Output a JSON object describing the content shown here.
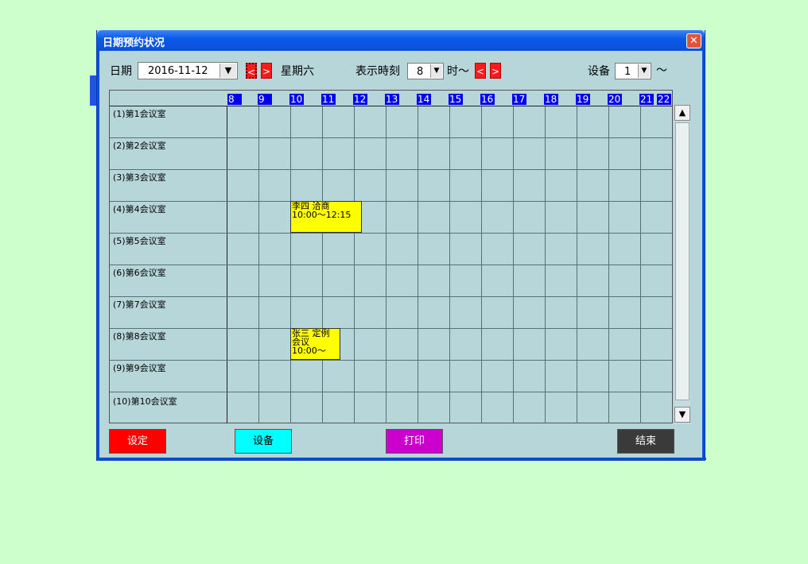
{
  "window": {
    "title": "日期预约状况",
    "close_icon": "close-icon"
  },
  "toolbar": {
    "date_label": "日期",
    "date_value": "2016-11-12",
    "weekday": "星期六",
    "display_time_label": "表示時刻",
    "display_time_value": "8",
    "hour_suffix": "时～",
    "device_label": "设备",
    "device_value": "1",
    "device_suffix": "～",
    "prev_symbol": "<",
    "next_symbol": ">"
  },
  "hours": [
    "8",
    "9",
    "10",
    "11",
    "12",
    "13",
    "14",
    "15",
    "16",
    "17",
    "18",
    "19",
    "20",
    "21",
    "22"
  ],
  "rooms": [
    "(1)第1会议室",
    "(2)第2会议室",
    "(3)第3会议室",
    "(4)第4会议室",
    "(5)第5会议室",
    "(6)第6会议室",
    "(7)第7会议室",
    "(8)第8会议室",
    "(9)第9会议室",
    "(10)第10会议室"
  ],
  "bookings": [
    {
      "line1": "李四 洽商",
      "line2": "10:00～12:15",
      "line3": ""
    },
    {
      "line1": "张三 定例",
      "line2": "会议",
      "line3": "10:00～"
    }
  ],
  "buttons": {
    "settings": "设定",
    "device": "设备",
    "print": "打印",
    "end": "结束"
  },
  "colors": {
    "settings": "#ff0000",
    "device": "#00ffff",
    "print": "#cc00cc",
    "end": "#3a3a3a",
    "booking": "#ffff00",
    "hour_header": "#0000ee"
  }
}
